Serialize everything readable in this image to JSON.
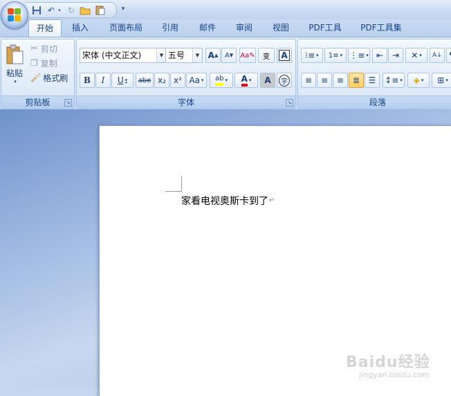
{
  "qat": {
    "save_icon": "save-icon",
    "undo_icon": "undo-icon",
    "redo_icon": "redo-icon",
    "open_icon": "open-folder-icon",
    "paste_icon": "paste-icon",
    "more": "▾"
  },
  "tabs": [
    {
      "label": "开始",
      "active": true
    },
    {
      "label": "插入"
    },
    {
      "label": "页面布局"
    },
    {
      "label": "引用"
    },
    {
      "label": "邮件"
    },
    {
      "label": "审阅"
    },
    {
      "label": "视图"
    },
    {
      "label": "PDF工具"
    },
    {
      "label": "PDF工具集"
    }
  ],
  "clipboard": {
    "paste_label": "粘贴",
    "cut_label": "剪切",
    "copy_label": "复制",
    "format_painter_label": "格式刷",
    "group_label": "剪贴板"
  },
  "font": {
    "font_name": "宋体 (中文正文)",
    "font_size": "五号",
    "group_label": "字体",
    "bold": "B",
    "italic": "I",
    "underline": "U",
    "strike": "abe",
    "sub": "x₂",
    "sup": "x²",
    "case": "Aa",
    "grow": "A",
    "shrink": "A",
    "clear": "A",
    "pinyin": "变",
    "char_border": "A",
    "char_shade": "A",
    "enclose": "字"
  },
  "paragraph": {
    "group_label": "段落"
  },
  "document": {
    "text": "家看电视奥斯卡到了",
    "para_mark": "↵"
  },
  "watermark": {
    "logo": "Baidu经验",
    "sub": "jingyan.baidu.com"
  },
  "colors": {
    "highlight": "#ffff00",
    "font_color": "#ff0000",
    "accent": "#15428b"
  }
}
